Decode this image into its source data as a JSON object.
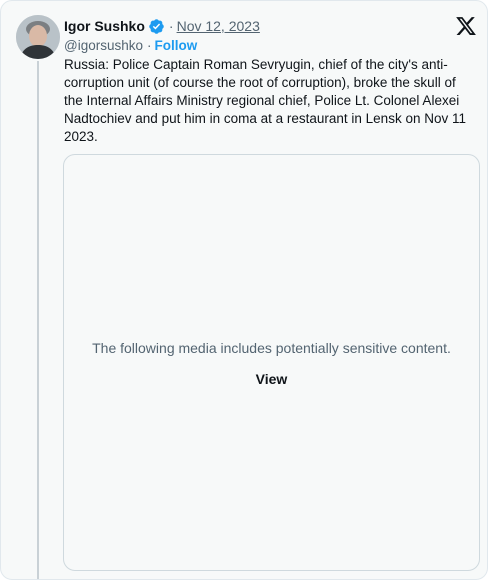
{
  "author": {
    "display_name": "Igor Sushko",
    "handle": "@igorsushko",
    "verified_icon": "verified-badge-icon",
    "verified_color": "#1d9bf0"
  },
  "meta": {
    "separator": "·",
    "date": "Nov 12, 2023",
    "follow_label": "Follow"
  },
  "platform_icon": "x-logo-icon",
  "tweet": {
    "text": "Russia: Police Captain Roman Sevryugin, chief of the city's anti-corruption unit (of course the root of corruption), broke the skull of the Internal Affairs Ministry regional chief, Police Lt. Colonel Alexei Nadtochiev and put him in coma at a restaurant in Lensk on Nov 11 2023."
  },
  "media": {
    "warning": "The following media includes potentially sensitive content.",
    "view_label": "View"
  },
  "colors": {
    "accent": "#1d9bf0",
    "text_primary": "#0f1419",
    "text_secondary": "#536471",
    "card_bg": "#f7f9f9"
  }
}
